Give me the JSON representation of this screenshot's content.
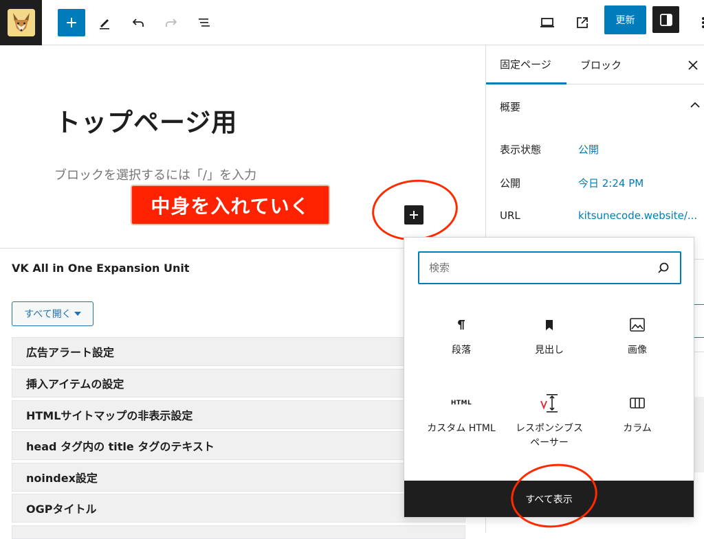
{
  "toolbar": {
    "add_block_label": "+",
    "update_label": "更新"
  },
  "editor": {
    "title": "トップページ用",
    "placeholder": "ブロックを選択するには「/」を入力",
    "annotation": "中身を入れていく"
  },
  "metabox": {
    "title": "VK All in One Expansion Unit",
    "open_all": "すべて開く",
    "sections": [
      "広告アラート設定",
      "挿入アイテムの設定",
      "HTMLサイトマップの非表示設定",
      "head タグ内の title タグのテキスト",
      "noindex設定",
      "OGPタイトル"
    ]
  },
  "sidebar": {
    "tabs": [
      "固定ページ",
      "ブロック"
    ],
    "section_title": "概要",
    "rows": [
      {
        "label": "表示状態",
        "value": "公開"
      },
      {
        "label": "公開",
        "value": "今日 2:24 PM"
      },
      {
        "label": "URL",
        "value": "kitsunecode.website/..."
      }
    ]
  },
  "inserter": {
    "search_placeholder": "検索",
    "blocks": [
      {
        "label": "段落",
        "icon": "paragraph-icon"
      },
      {
        "label": "見出し",
        "icon": "heading-icon"
      },
      {
        "label": "画像",
        "icon": "image-icon"
      },
      {
        "label": "カスタム HTML",
        "icon": "html-icon"
      },
      {
        "label": "レスポンシブスペーサー",
        "icon": "spacer-icon"
      },
      {
        "label": "カラム",
        "icon": "columns-icon"
      }
    ],
    "show_all": "すべて表示",
    "html_icon_text": "HTML"
  },
  "colors": {
    "accent": "#007cba",
    "annotation": "#ff2200",
    "dark": "#1e1e1e"
  }
}
